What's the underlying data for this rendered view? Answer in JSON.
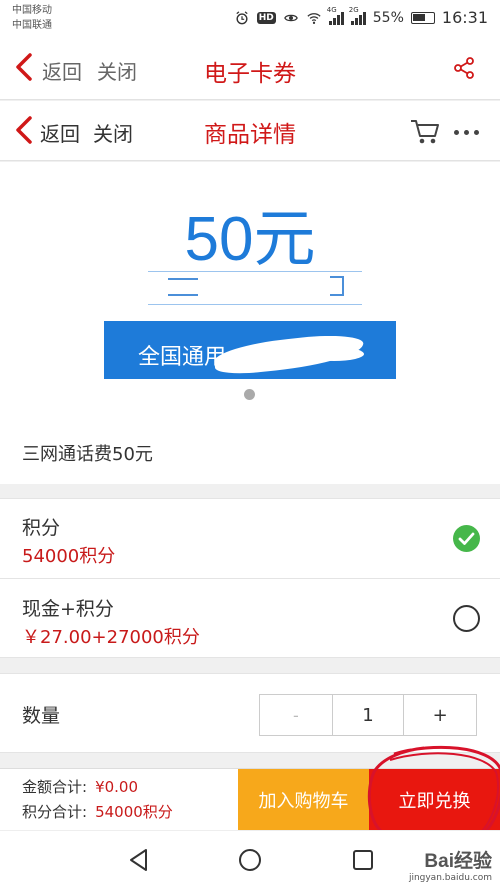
{
  "status_bar": {
    "carriers": [
      "中国移动",
      "中国联通"
    ],
    "battery_percent": "55%",
    "time": "16:31",
    "icons": [
      "alarm-icon",
      "hd-icon",
      "eye-icon",
      "wifi-icon",
      "signal-4g-icon",
      "signal-2g-icon",
      "battery-icon"
    ],
    "net_4g": "4G",
    "net_2g": "2G",
    "hd": "HD"
  },
  "outer_header": {
    "back_label": "返回",
    "close_label": "关闭",
    "title": "电子卡券",
    "share_icon": "share-icon"
  },
  "inner_header": {
    "back_label": "返回",
    "close_label": "关闭",
    "title": "商品详情",
    "cart_icon": "cart-icon",
    "more_icon": "more-icon"
  },
  "product": {
    "amount": "50元",
    "banner_text": "全国通用",
    "name": "三网通话费50元"
  },
  "payment_options": [
    {
      "label": "积分",
      "price": "54000积分",
      "selected": true
    },
    {
      "label": "现金+积分",
      "price": "￥27.00+27000积分",
      "selected": false
    }
  ],
  "quantity": {
    "label": "数量",
    "minus": "-",
    "value": "1",
    "plus": "+"
  },
  "footer": {
    "total_amount_label": "金额合计:",
    "total_amount_value": "¥0.00",
    "total_points_label": "积分合计:",
    "total_points_value": "54000积分",
    "add_to_cart": "加入购物车",
    "redeem_now": "立即兑换"
  },
  "nav": [
    "back-icon",
    "home-icon",
    "recent-apps-icon"
  ],
  "watermark": {
    "brand": "Bai经验",
    "url": "jingyan.baidu.com"
  },
  "colors": {
    "accent_red": "#e8170f",
    "title_red": "#d01818",
    "price_red": "#c81a1a",
    "blue": "#1e7bd9",
    "orange": "#f7a81b",
    "check_green": "#46b74a"
  }
}
